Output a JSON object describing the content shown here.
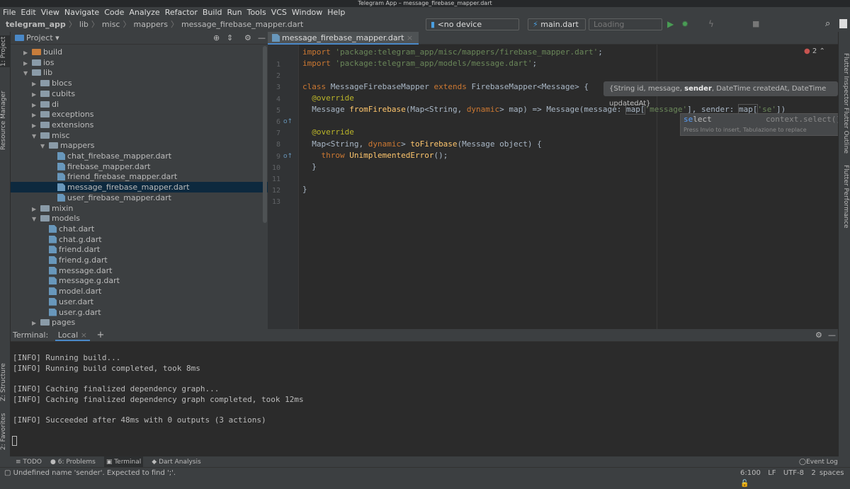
{
  "window": {
    "title": "Telegram App – message_firebase_mapper.dart"
  },
  "menu": [
    "File",
    "Edit",
    "View",
    "Navigate",
    "Code",
    "Analyze",
    "Refactor",
    "Build",
    "Run",
    "Tools",
    "VCS",
    "Window",
    "Help"
  ],
  "breadcrumb": [
    "telegram_app",
    "lib",
    "misc",
    "mappers",
    "message_firebase_mapper.dart"
  ],
  "toolbar": {
    "device": "<no device selected>",
    "config": "main.dart",
    "loading": "Loading Devices..."
  },
  "left_tabs": [
    "1: Project",
    "Resource Manager",
    "Z: Structure",
    "2: Favorites"
  ],
  "right_tabs": [
    "Flutter Inspector",
    "Flutter Outline",
    "Flutter Performance"
  ],
  "project": {
    "title": "Project",
    "tree": [
      {
        "label": "build",
        "depth": 1,
        "type": "folder",
        "expanded": false
      },
      {
        "label": "ios",
        "depth": 1,
        "type": "folder",
        "expanded": false
      },
      {
        "label": "lib",
        "depth": 1,
        "type": "folder",
        "expanded": true
      },
      {
        "label": "blocs",
        "depth": 2,
        "type": "folder",
        "expanded": false
      },
      {
        "label": "cubits",
        "depth": 2,
        "type": "folder",
        "expanded": false
      },
      {
        "label": "di",
        "depth": 2,
        "type": "folder",
        "expanded": false
      },
      {
        "label": "exceptions",
        "depth": 2,
        "type": "folder",
        "expanded": false
      },
      {
        "label": "extensions",
        "depth": 2,
        "type": "folder",
        "expanded": false
      },
      {
        "label": "misc",
        "depth": 2,
        "type": "folder",
        "expanded": true
      },
      {
        "label": "mappers",
        "depth": 3,
        "type": "folder",
        "expanded": true
      },
      {
        "label": "chat_firebase_mapper.dart",
        "depth": 4,
        "type": "file"
      },
      {
        "label": "firebase_mapper.dart",
        "depth": 4,
        "type": "file"
      },
      {
        "label": "friend_firebase_mapper.dart",
        "depth": 4,
        "type": "file"
      },
      {
        "label": "message_firebase_mapper.dart",
        "depth": 4,
        "type": "file",
        "selected": true
      },
      {
        "label": "user_firebase_mapper.dart",
        "depth": 4,
        "type": "file"
      },
      {
        "label": "mixin",
        "depth": 2,
        "type": "folder",
        "expanded": false
      },
      {
        "label": "models",
        "depth": 2,
        "type": "folder",
        "expanded": true
      },
      {
        "label": "chat.dart",
        "depth": 3,
        "type": "file"
      },
      {
        "label": "chat.g.dart",
        "depth": 3,
        "type": "file"
      },
      {
        "label": "friend.dart",
        "depth": 3,
        "type": "file"
      },
      {
        "label": "friend.g.dart",
        "depth": 3,
        "type": "file"
      },
      {
        "label": "message.dart",
        "depth": 3,
        "type": "file"
      },
      {
        "label": "message.g.dart",
        "depth": 3,
        "type": "file"
      },
      {
        "label": "model.dart",
        "depth": 3,
        "type": "file"
      },
      {
        "label": "user.dart",
        "depth": 3,
        "type": "file"
      },
      {
        "label": "user.g.dart",
        "depth": 3,
        "type": "file"
      },
      {
        "label": "pages",
        "depth": 2,
        "type": "folder",
        "expanded": false
      }
    ]
  },
  "editor": {
    "tab": "message_firebase_mapper.dart",
    "error_count": "2",
    "lines": [
      [
        [
          "kw",
          "import "
        ],
        [
          "str",
          "'package:telegram_app/misc/mappers/firebase_mapper.dart'"
        ],
        [
          "",
          "; "
        ]
      ],
      [
        [
          "kw",
          "import "
        ],
        [
          "str",
          "'package:telegram_app/models/message.dart'"
        ],
        [
          "",
          ";"
        ]
      ],
      [],
      [
        [
          "kw",
          "class "
        ],
        [
          "",
          "MessageFirebaseMapper "
        ],
        [
          "kw",
          "extends "
        ],
        [
          "",
          "FirebaseMapper<Message> {"
        ]
      ],
      [
        [
          "ann",
          "  @override"
        ]
      ],
      [
        [
          "",
          "  Message "
        ],
        [
          "fn",
          "fromFirebase"
        ],
        [
          "",
          "(Map<String, "
        ],
        [
          "kw",
          "dynamic"
        ],
        [
          "",
          "> map) => Message(message: "
        ],
        [
          "box",
          "map["
        ],
        [
          "str",
          "'message'"
        ],
        [
          "",
          "], sender: "
        ],
        [
          "box",
          "map["
        ],
        [
          "str",
          "'se'"
        ],
        [
          "",
          "])"
        ]
      ],
      [],
      [
        [
          "ann",
          "  @override"
        ]
      ],
      [
        [
          "",
          "  Map<String, "
        ],
        [
          "kw",
          "dynamic"
        ],
        [
          "",
          "> "
        ],
        [
          "fn",
          "toFirebase"
        ],
        [
          "",
          "(Message object) {"
        ]
      ],
      [
        [
          "kw",
          "    throw "
        ],
        [
          "fn",
          "UnimplementedError"
        ],
        [
          "",
          "();"
        ]
      ],
      [
        [
          "",
          "  }"
        ]
      ],
      [],
      [
        [
          "",
          "}"
        ]
      ]
    ],
    "param_hint": {
      "before": "{String id, message, ",
      "current": "sender",
      "after": ", DateTime createdAt, DateTime updatedAt}"
    },
    "completion": {
      "match": "se",
      "rest": "lect",
      "detail": "context.select()",
      "hint": "Press Invio to insert, Tabulazione to replace"
    }
  },
  "terminal": {
    "label": "Terminal:",
    "tab": "Local",
    "lines": [
      "[INFO] Running build...",
      "[INFO] Running build completed, took 8ms",
      "",
      "[INFO] Caching finalized dependency graph...",
      "[INFO] Caching finalized dependency graph completed, took 12ms",
      "",
      "[INFO] Succeeded after 48ms with 0 outputs (3 actions)"
    ]
  },
  "tool_windows": [
    "TODO",
    "6: Problems",
    "Terminal",
    "Dart Analysis"
  ],
  "event_log": "Event Log",
  "status": {
    "message": "Undefined name 'sender'. Expected to find ';'.",
    "position": "6:100",
    "line_sep": "LF",
    "encoding": "UTF-8",
    "indent": "2 spaces"
  },
  "colors": {
    "editor_bg": "#2b2b2b",
    "panel_bg": "#3c3f41",
    "selection": "#0d293e",
    "keyword": "#cc7832",
    "string": "#6a8759",
    "annotation": "#bbb529",
    "function": "#ffc66d"
  }
}
